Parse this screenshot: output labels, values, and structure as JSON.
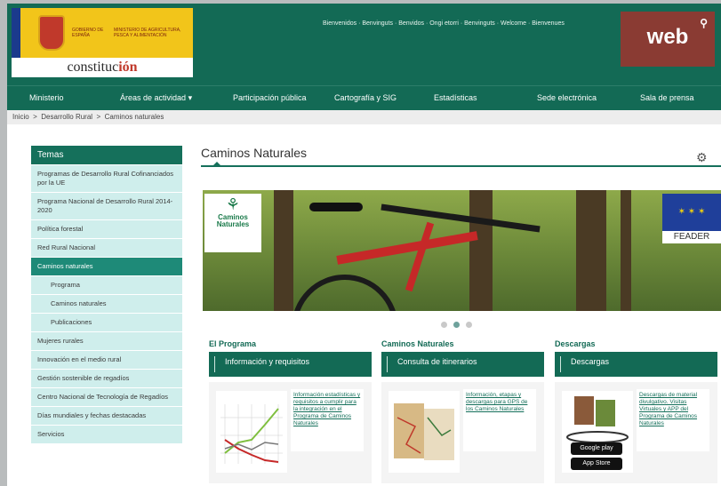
{
  "header": {
    "gov_text": "GOBIERNO DE ESPAÑA",
    "ministry_text": "MINISTERIO DE AGRICULTURA, PESCA Y ALIMENTACIÓN",
    "constitucion": "constituc",
    "constitucion_flag": "ión",
    "welcome": "Bienvenidos · Benvinguts · Benvidos · Ongi etorri · Benvinguts · Welcome · Bienvenues",
    "web_label": "web",
    "search_glyph": "⚲"
  },
  "nav": {
    "items": [
      "Ministerio",
      "Áreas de actividad",
      "Participación pública",
      "Cartografía y SIG",
      "Estadísticas",
      "Sede electrónica",
      "Sala de prensa"
    ],
    "dropdown_caret": "▾"
  },
  "breadcrumb": {
    "home": "Inicio",
    "sep": ">",
    "level1": "Desarrollo Rural",
    "level2": "Caminos naturales"
  },
  "sidebar": {
    "heading": "Temas",
    "items": [
      "Programas de Desarrollo Rural Cofinanciados por la UE",
      "Programa Nacional de Desarrollo Rural 2014-2020",
      "Política forestal",
      "Red Rural Nacional",
      "Caminos naturales",
      "Programa",
      "Caminos naturales",
      "Publicaciones",
      "Mujeres rurales",
      "Innovación en el medio rural",
      "Gestión sostenible de regadíos",
      "Centro Nacional de Tecnología de Regadíos",
      "Días mundiales y fechas destacadas",
      "Servicios"
    ]
  },
  "main": {
    "title": "Caminos Naturales",
    "gear_glyph": "⚙",
    "banner": {
      "logo_symbol": "⚘",
      "logo_line1": "Caminos",
      "logo_line2": "Naturales",
      "eu_stars": "✶ ✶ ✶",
      "feader": "FEADER"
    }
  },
  "sections": [
    {
      "title": "El Programa",
      "bar": "Información y requisitos",
      "link": "Información estadísticas y requisitos a cumplir para la integración en el Programa de Caminos Naturales"
    },
    {
      "title": "Caminos Naturales",
      "bar": "Consulta de itinerarios",
      "link": "Información, etapas y descargas para GPS de los Caminos Naturales"
    },
    {
      "title": "Descargas",
      "bar": "Descargas",
      "link": "Descargas de material divulgativo. Visitas Virtuales y APP del Programa de Caminos Naturales",
      "store1": "Google play",
      "store2": "App Store"
    }
  ],
  "colors": {
    "brand_green": "#136a55",
    "sidebar_bg": "#cfeeec",
    "active_item": "#1e8a78",
    "web_button": "#8a3b33"
  }
}
